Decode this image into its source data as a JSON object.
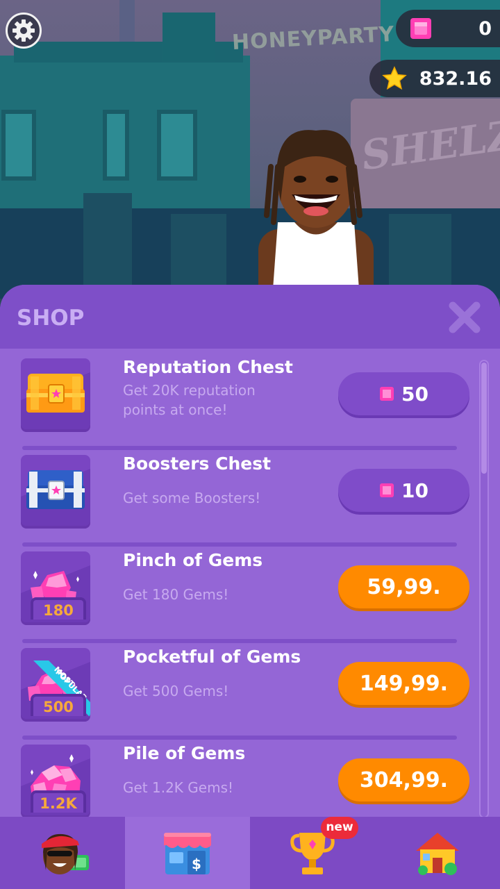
{
  "hud": {
    "gems_value": "0",
    "stars_value": "832.16",
    "gem_icon": "gem-icon",
    "star_icon": "star-icon",
    "settings_icon": "gear-icon"
  },
  "scene": {
    "sign_text": "HONEYPARTY",
    "board_text": "SHELZ"
  },
  "shop": {
    "title": "SHOP",
    "close_icon": "close-icon",
    "items": [
      {
        "title": "Reputation Chest",
        "description": "Get 20K reputation points at once!",
        "price": "50",
        "price_type": "gems",
        "icon": "gold-chest-icon"
      },
      {
        "title": "Boosters Chest",
        "description": "Get some Boosters!",
        "price": "10",
        "price_type": "gems",
        "icon": "blue-chest-icon"
      },
      {
        "title": "Pinch of Gems",
        "description": "Get 180 Gems!",
        "price": "59,99.",
        "price_type": "money",
        "icon": "gem-pack-icon",
        "amount": "180"
      },
      {
        "title": "Pocketful of Gems",
        "description": "Get 500 Gems!",
        "price": "149,99.",
        "price_type": "money",
        "icon": "gem-pack-icon",
        "amount": "500",
        "ribbon": "MOST POPULAR"
      },
      {
        "title": "Pile of Gems",
        "description": "Get 1.2K Gems!",
        "price": "304,99.",
        "price_type": "money",
        "icon": "gem-pile-icon",
        "amount": "1.2K"
      }
    ]
  },
  "nav": {
    "items": [
      {
        "name": "character",
        "icon": "character-icon"
      },
      {
        "name": "shop",
        "icon": "shop-icon",
        "active": true
      },
      {
        "name": "trophies",
        "icon": "trophy-icon",
        "badge": "new"
      },
      {
        "name": "home",
        "icon": "house-icon"
      }
    ]
  },
  "colors": {
    "panel": "#9466d6",
    "panel_header": "#7e4fc8",
    "money_button": "#ff8a00",
    "gem_button": "#7f4cc9",
    "gem": "#ff3fb4",
    "badge": "#ec2b3a"
  }
}
